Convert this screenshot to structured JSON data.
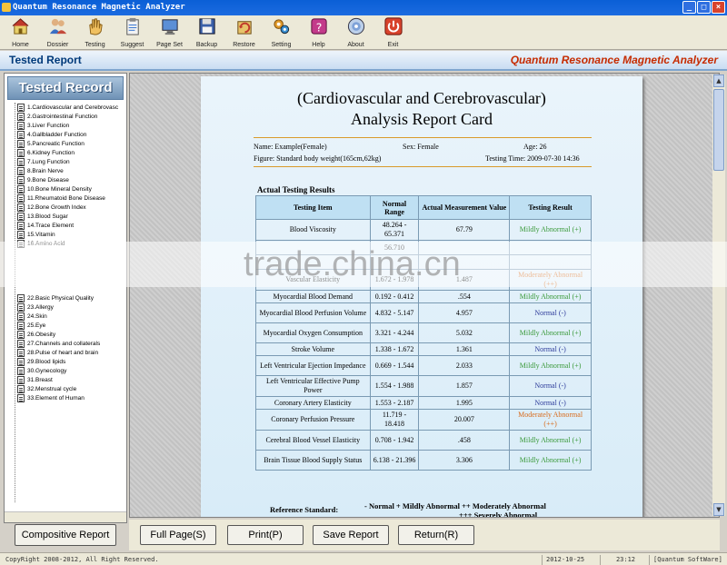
{
  "window": {
    "title": "Quantum Resonance Magnetic Analyzer",
    "controls": [
      "_",
      "□",
      "×"
    ]
  },
  "toolbar": [
    {
      "label": "Home",
      "icon": "home-icon"
    },
    {
      "label": "Dossier",
      "icon": "people-icon"
    },
    {
      "label": "Testing",
      "icon": "hand-icon"
    },
    {
      "label": "Suggest",
      "icon": "clipboard-icon"
    },
    {
      "label": "Page Set",
      "icon": "monitor-icon"
    },
    {
      "label": "Backup",
      "icon": "disk-icon"
    },
    {
      "label": "Restore",
      "icon": "restore-icon"
    },
    {
      "label": "Setting",
      "icon": "gears-icon"
    },
    {
      "label": "Help",
      "icon": "question-icon"
    },
    {
      "label": "About",
      "icon": "disc-icon"
    },
    {
      "label": "Exit",
      "icon": "power-icon"
    }
  ],
  "header": {
    "left": "Tested Report",
    "right": "Quantum Resonance Magnetic Analyzer"
  },
  "sidebar": {
    "title": "Tested Record",
    "items": [
      "1.Cardiovascular and Cerebrovasc",
      "2.Gastrointestinal Function",
      "3.Liver Function",
      "4.Gallbladder Function",
      "5.Pancreatic Function",
      "6.Kidney Function",
      "7.Lung Function",
      "8.Brain Nerve",
      "9.Bone Disease",
      "10.Bone Mineral Density",
      "11.Rheumatoid Bone Disease",
      "12.Bone Growth Index",
      "13.Blood Sugar",
      "14.Trace Element",
      "15.Vitamin",
      "16.Amino Acid"
    ],
    "items_lower": [
      "22.Basic Physical Quality",
      "23.Allergy",
      "24.Skin",
      "25.Eye",
      "26.Obesity",
      "27.Channels and collaterals",
      "28.Pulse of heart and brain",
      "29.Blood lipids",
      "30.Gynecology",
      "31.Breast",
      "32.Menstrual cycle",
      "33.Element of Human"
    ],
    "button": "Compositive Report"
  },
  "report": {
    "title_line1": "(Cardiovascular and Cerebrovascular)",
    "title_line2": "Analysis Report Card",
    "name": "Name: Example(Female)",
    "sex": "Sex: Female",
    "age": "Age: 26",
    "figure": "Figure: Standard body weight(165cm,62kg)",
    "testing_time": "Testing Time: 2009-07-30 14:36",
    "section": "Actual Testing Results",
    "headers": [
      "Testing Item",
      "Normal Range",
      "Actual Measurement Value",
      "Testing Result"
    ],
    "rows": [
      {
        "item": "Blood Viscosity",
        "range": "48.264 - 65.371",
        "value": "67.79",
        "result": "Mildly Abnormal (+)",
        "cls": "mild"
      },
      {
        "item": "",
        "range": "56.710",
        "value": "",
        "result": "",
        "cls": "mild"
      },
      {
        "item": "",
        "range": "",
        "value": "",
        "result": "",
        "cls": "mild"
      },
      {
        "item": "Vascular Elasticity",
        "range": "1.672 - 1.978",
        "value": "1.487",
        "result": "Moderately Abnormal (++)",
        "cls": "mod"
      },
      {
        "item": "Myocardial Blood Demand",
        "range": "0.192 - 0.412",
        "value": ".554",
        "result": "Mildly Abnormal (+)",
        "cls": "mild"
      },
      {
        "item": "Myocardial Blood Perfusion Volume",
        "range": "4.832 - 5.147",
        "value": "4.957",
        "result": "Normal (-)",
        "cls": "norm"
      },
      {
        "item": "Myocardial Oxygen Consumption",
        "range": "3.321 - 4.244",
        "value": "5.032",
        "result": "Mildly Abnormal (+)",
        "cls": "mild"
      },
      {
        "item": "Stroke Volume",
        "range": "1.338 - 1.672",
        "value": "1.361",
        "result": "Normal (-)",
        "cls": "norm"
      },
      {
        "item": "Left Ventricular Ejection Impedance",
        "range": "0.669 - 1.544",
        "value": "2.033",
        "result": "Mildly Abnormal (+)",
        "cls": "mild"
      },
      {
        "item": "Left Ventricular Effective Pump Power",
        "range": "1.554 - 1.988",
        "value": "1.857",
        "result": "Normal (-)",
        "cls": "norm"
      },
      {
        "item": "Coronary Artery Elasticity",
        "range": "1.553 - 2.187",
        "value": "1.995",
        "result": "Normal (-)",
        "cls": "norm"
      },
      {
        "item": "Coronary Perfusion Pressure",
        "range": "11.719 - 18.418",
        "value": "20.007",
        "result": "Moderately Abnormal (++)",
        "cls": "mod"
      },
      {
        "item": "Cerebral Blood Vessel Elasticity",
        "range": "0.708 - 1.942",
        "value": ".458",
        "result": "Mildly Abnormal (+)",
        "cls": "mild"
      },
      {
        "item": "Brain Tissue Blood Supply Status",
        "range": "6.138 - 21.396",
        "value": "3.306",
        "result": "Mildly Abnormal (+)",
        "cls": "mild"
      }
    ],
    "ref_label": "Reference Standard:",
    "ref_legend1": "- Normal    + Mildly Abnormal    ++ Moderately Abnormal",
    "ref_legend2": "+++ Severely Abnormal"
  },
  "watermark": "trade.china.cn",
  "buttons": [
    "Full Page(S)",
    "Print(P)",
    "Save Report",
    "Return(R)"
  ],
  "status": {
    "copyright": "CopyRight 2008-2012, All Right Reserved.",
    "date": "2012-10-25",
    "time": "23:12",
    "product": "[Quantum SoftWare]"
  },
  "colors": {
    "title_bar": "#0a5fd6",
    "mild": "#3b9a3b",
    "moderate": "#d86a1a",
    "normal": "#2c3a9a",
    "header_right": "#c62b00"
  }
}
